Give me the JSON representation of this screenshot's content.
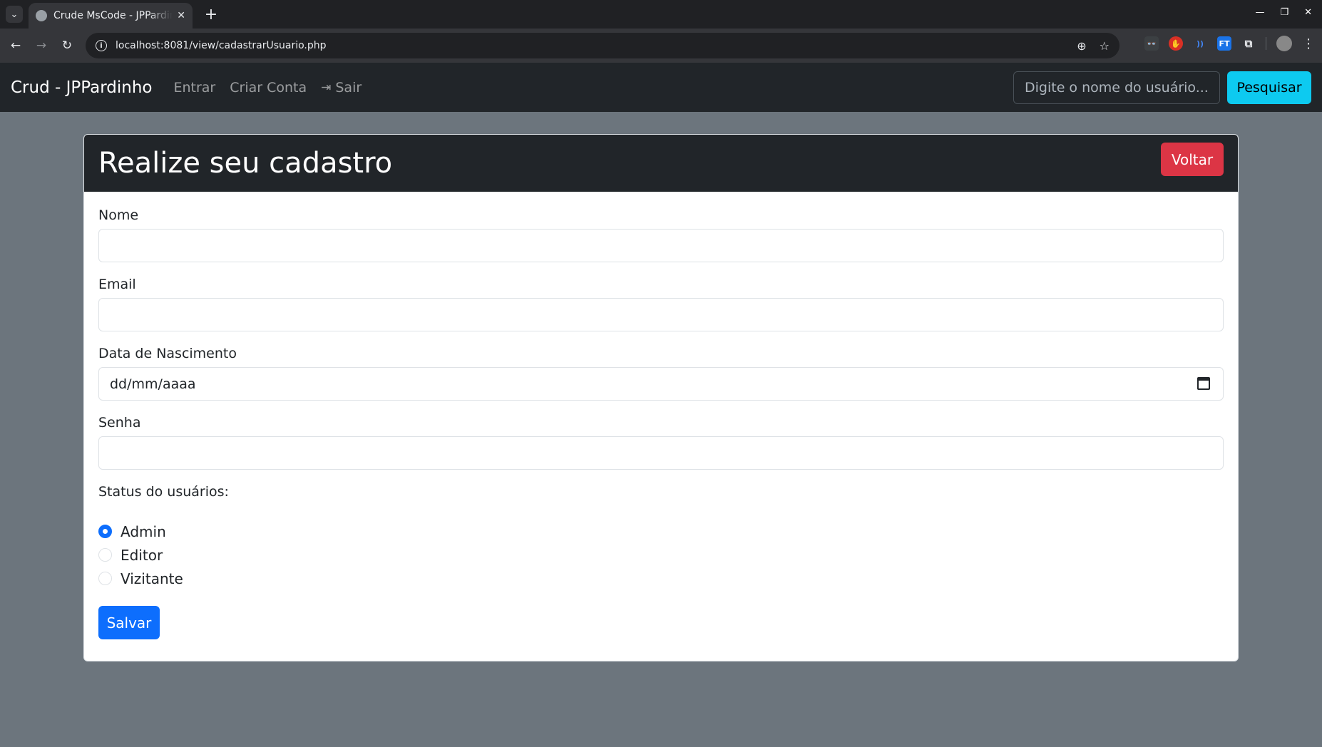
{
  "browser": {
    "tab_title": "Crude MsCode - JPPardinho",
    "tab_close": "✕",
    "new_tab": "+",
    "url": "localhost:8081/view/cadastrarUsuario.php"
  },
  "navbar": {
    "brand": "Crud - JPPardinho",
    "links": [
      "Entrar",
      "Criar Conta",
      "Sair"
    ],
    "search_placeholder": "Digite o nome do usuário...",
    "search_button": "Pesquisar"
  },
  "card": {
    "title": "Realize seu cadastro",
    "back_button": "Voltar",
    "fields": {
      "name_label": "Nome",
      "name_value": "",
      "email_label": "Email",
      "email_value": "",
      "birth_label": "Data de Nascimento",
      "birth_value": "dd/mm/aaaa",
      "password_label": "Senha",
      "password_value": ""
    },
    "status_label": "Status do usuários:",
    "status_options": [
      "Admin",
      "Editor",
      "Vizitante"
    ],
    "status_selected": "Admin",
    "save_button": "Salvar"
  },
  "colors": {
    "navbar_bg": "#212529",
    "page_bg": "#6c757d",
    "primary": "#0d6efd",
    "danger": "#dc3545",
    "info": "#0dcaf0"
  }
}
